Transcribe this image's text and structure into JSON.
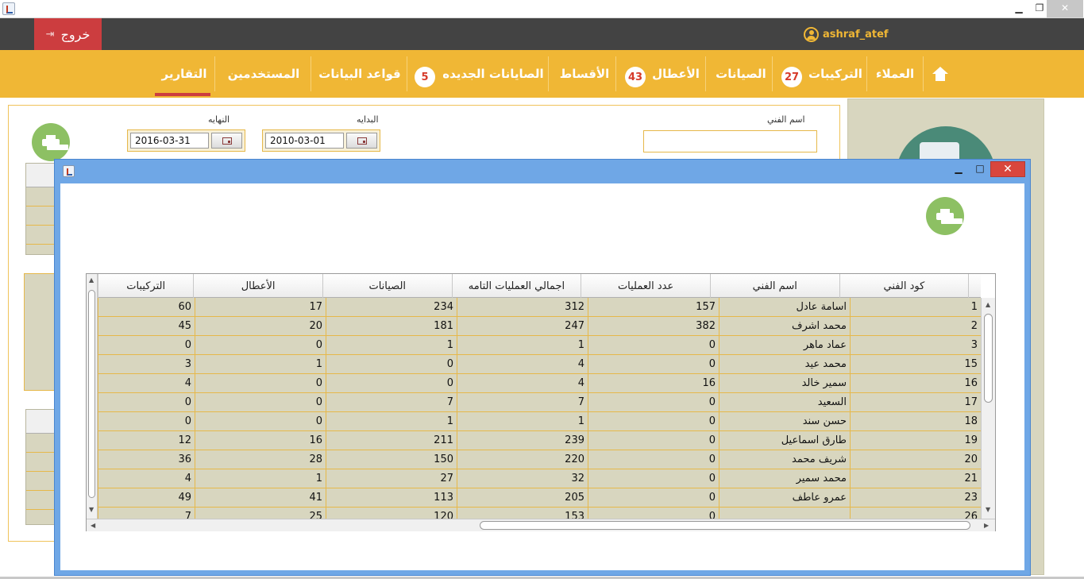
{
  "window": {
    "min_glyph": "▁",
    "max_glyph": "❐",
    "close_glyph": "✕"
  },
  "userbar": {
    "logout_label": "خروج",
    "username": "ashraf_atef"
  },
  "nav": {
    "home_icon": "home-icon",
    "items": [
      {
        "label": "العملاء"
      },
      {
        "label": "التركيبات",
        "badge": "27"
      },
      {
        "label": "الصيانات"
      },
      {
        "label": "الأعطال",
        "badge": "43"
      },
      {
        "label": "الأقساط"
      },
      {
        "label": "الصايانات الجديده",
        "badge": "5"
      },
      {
        "label": "قواعد البيانات"
      },
      {
        "label": "المستخدمين"
      },
      {
        "label": "التقارير",
        "active": true
      }
    ]
  },
  "filters": {
    "technician_label": "اسم الفني",
    "technician_value": "",
    "start_label": "البدايه",
    "start_value": "2010-03-01",
    "end_label": "النهايه",
    "end_value": "2016-03-31"
  },
  "dialog": {
    "min_glyph": "▁",
    "max_glyph": "□",
    "close_glyph": "✕"
  },
  "table": {
    "columns": [
      "كود الفني",
      "اسم الفني",
      "عدد العمليات",
      "اجمالي العمليات التامه",
      "الصيانات",
      "الأعطال",
      "التركيبات"
    ],
    "rows": [
      [
        "1",
        "اسامة عادل",
        "157",
        "312",
        "234",
        "17",
        "60"
      ],
      [
        "2",
        "محمد اشرف",
        "382",
        "247",
        "181",
        "20",
        "45"
      ],
      [
        "3",
        "عماد ماهر",
        "0",
        "1",
        "1",
        "0",
        "0"
      ],
      [
        "15",
        "محمد عيد",
        "0",
        "4",
        "0",
        "1",
        "3"
      ],
      [
        "16",
        "سمير خالد",
        "16",
        "4",
        "0",
        "0",
        "4"
      ],
      [
        "17",
        "السعيد",
        "0",
        "7",
        "7",
        "0",
        "0"
      ],
      [
        "18",
        "حسن سند",
        "0",
        "1",
        "1",
        "0",
        "0"
      ],
      [
        "19",
        "طارق اسماعيل",
        "0",
        "239",
        "211",
        "16",
        "12"
      ],
      [
        "20",
        "شريف محمد",
        "0",
        "220",
        "150",
        "28",
        "36"
      ],
      [
        "21",
        "محمد سمير",
        "0",
        "32",
        "27",
        "1",
        "4"
      ],
      [
        "23",
        "عمرو عاطف",
        "0",
        "205",
        "113",
        "41",
        "49"
      ],
      [
        "26",
        "",
        "0",
        "153",
        "120",
        "25",
        "7"
      ]
    ]
  },
  "colors": {
    "nav_bg": "#f0b735",
    "userbar_bg": "#434343",
    "logout_bg": "#cc3d3f",
    "row_bg": "#d8d6bf",
    "grid_line": "#e6b84a",
    "print_green": "#8dc063"
  }
}
